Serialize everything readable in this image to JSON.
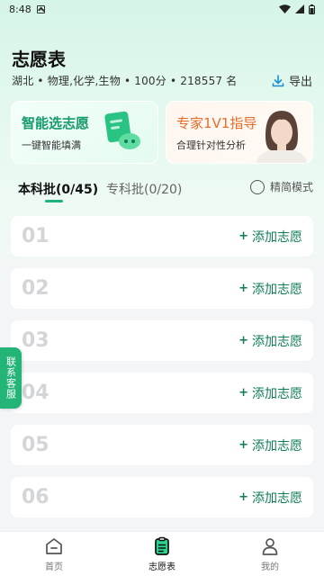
{
  "status_bar": {
    "time": "8:48"
  },
  "header": {
    "title": "志愿表",
    "subtitle": "湖北 • 物理,化学,生物 • 100分 • 218557 名",
    "export_label": "导出"
  },
  "cards": {
    "smart": {
      "title": "智能选志愿",
      "subtitle": "一键智能填满"
    },
    "expert": {
      "title": "专家1V1指导",
      "subtitle": "合理针对性分析"
    }
  },
  "tabs": {
    "bachelor": "本科批(0/45)",
    "junior": "专科批(0/20)",
    "simple_mode": "精简模式"
  },
  "list": {
    "add_label": "添加志愿",
    "rows": [
      "01",
      "02",
      "03",
      "04",
      "05",
      "06"
    ]
  },
  "side_service": {
    "label": "联系客服"
  },
  "bottom_nav": {
    "home": "首页",
    "volunteer_table": "志愿表",
    "mine": "我的"
  },
  "colors": {
    "accent": "#1fb37a",
    "accent_dark": "#0f7d57",
    "expert_orange": "#e56d2a"
  }
}
